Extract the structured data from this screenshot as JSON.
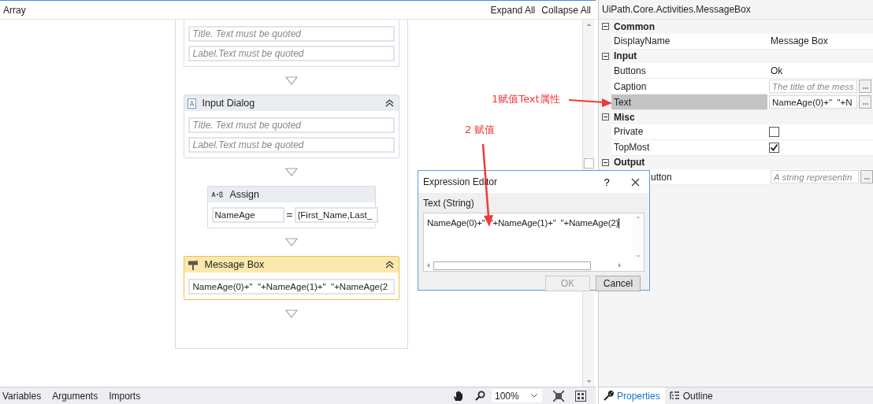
{
  "designer": {
    "title": "Array",
    "actions": [
      "Expand All",
      "Collapse All"
    ],
    "activities": [
      {
        "kind": "cut",
        "fields": [
          {
            "placeholder": "Title. Text must be quoted"
          },
          {
            "placeholder": "Label.Text must be quoted"
          }
        ]
      },
      {
        "kind": "input_dialog",
        "title": "Input Dialog",
        "selected": false,
        "fields": [
          {
            "placeholder": "Title. Text must be quoted"
          },
          {
            "placeholder": "Label.Text must be quoted"
          }
        ]
      },
      {
        "kind": "assign",
        "title": "Assign",
        "to": "NameAge",
        "value": "{First_Name,Last_",
        "selected": false
      },
      {
        "kind": "message_box",
        "title": "Message Box",
        "selected": true,
        "value": "NameAge(0)+\"  \"+NameAge(1)+\"  \"+NameAge(2"
      }
    ]
  },
  "bottom_tabs": [
    "Variables",
    "Arguments",
    "Imports"
  ],
  "zoom": "100%",
  "properties": {
    "title": "UiPath.Core.Activities.MessageBox",
    "categories": [
      {
        "name": "Common",
        "expanded": true,
        "rows": [
          {
            "name": "DisplayName",
            "kind": "text",
            "value": "Message Box",
            "selected": false
          }
        ]
      },
      {
        "name": "Input",
        "expanded": true,
        "rows": [
          {
            "name": "Buttons",
            "kind": "text",
            "value": "Ok",
            "selected": false
          },
          {
            "name": "Caption",
            "kind": "field",
            "placeholder": "The title of the mess",
            "selected": false
          },
          {
            "name": "Text",
            "kind": "field",
            "value": "NameAge(0)+\"  \"+N",
            "selected": true
          }
        ]
      },
      {
        "name": "Misc",
        "expanded": true,
        "rows": [
          {
            "name": "Private",
            "kind": "checkbox",
            "checked": false,
            "selected": false
          },
          {
            "name": "TopMost",
            "kind": "checkbox",
            "checked": true,
            "selected": false
          }
        ]
      },
      {
        "name": "Output",
        "expanded": true,
        "rows": [
          {
            "name": "utton",
            "kind": "field",
            "placeholder": "A string representin",
            "selected": false,
            "covered": true
          }
        ]
      }
    ]
  },
  "panel_tabs": [
    {
      "label": "Properties",
      "selected": true
    },
    {
      "label": "Outline",
      "selected": false
    }
  ],
  "dialog": {
    "title": "Expression Editor",
    "help": "?",
    "label": "Text (String)",
    "value": "NameAge(0)+\"  \"+NameAge(1)+\"  \"+NameAge(2)",
    "buttons": [
      {
        "label": "OK",
        "disabled": true
      },
      {
        "label": "Cancel",
        "disabled": false
      }
    ]
  },
  "annotations": [
    "1赋值Text属性",
    "2 赋值"
  ]
}
